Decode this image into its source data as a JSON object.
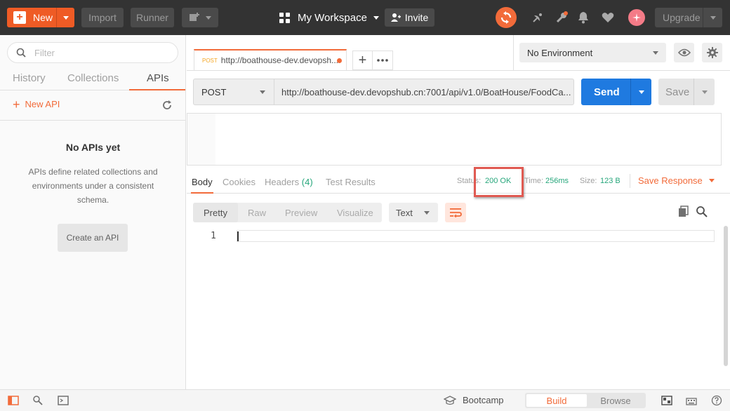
{
  "topbar": {
    "new_label": "New",
    "import_label": "Import",
    "runner_label": "Runner",
    "workspace_label": "My Workspace",
    "invite_label": "Invite",
    "upgrade_label": "Upgrade"
  },
  "sidebar": {
    "filter_placeholder": "Filter",
    "tabs": [
      {
        "label": "History"
      },
      {
        "label": "Collections"
      },
      {
        "label": "APIs"
      }
    ],
    "active_tab": "APIs",
    "new_api_label": "New API",
    "empty_title": "No APIs yet",
    "empty_description": "APIs define related collections and environments under a consistent schema.",
    "create_api_label": "Create an API"
  },
  "request_tab": {
    "method": "POST",
    "url": "http://boathouse-dev.devopsh..."
  },
  "environment": {
    "selected": "No Environment"
  },
  "request": {
    "method": "POST",
    "url": "http://boathouse-dev.devopshub.cn:7001/api/v1.0/BoatHouse/FoodCa...",
    "send_label": "Send",
    "save_label": "Save"
  },
  "response": {
    "tabs": {
      "body": "Body",
      "cookies": "Cookies",
      "headers": "Headers",
      "headers_count": "(4)",
      "test_results": "Test Results"
    },
    "status_label": "Status:",
    "status_value": "200 OK",
    "time_label": "Time:",
    "time_value": "256ms",
    "size_label": "Size:",
    "size_value": "123 B",
    "save_response_label": "Save Response",
    "views": {
      "pretty": "Pretty",
      "raw": "Raw",
      "preview": "Preview",
      "visualize": "Visualize"
    },
    "format": "Text",
    "line_number": "1"
  },
  "statusbar": {
    "bootcamp_label": "Bootcamp",
    "build_label": "Build",
    "browse_label": "Browse"
  },
  "colors": {
    "accent": "#f26b3a",
    "primary": "#1f7ae0",
    "success": "#26a67b",
    "highlight": "#e05a52"
  }
}
